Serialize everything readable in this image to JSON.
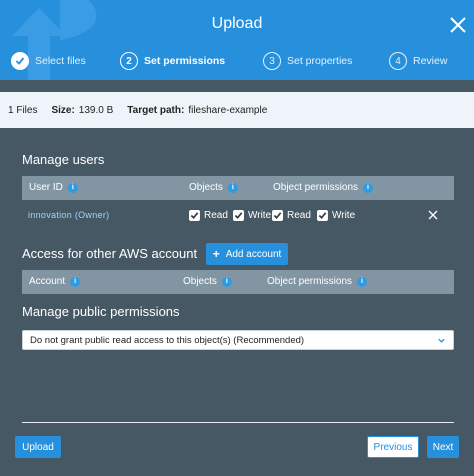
{
  "header": {
    "title": "Upload",
    "steps": [
      {
        "num": "1",
        "label": "Select files",
        "state": "done"
      },
      {
        "num": "2",
        "label": "Set permissions",
        "state": "active"
      },
      {
        "num": "3",
        "label": "Set properties",
        "state": "pending"
      },
      {
        "num": "4",
        "label": "Review",
        "state": "pending"
      }
    ]
  },
  "summary": {
    "files": "1 Files",
    "size_label": "Size:",
    "size_value": "139.0 B",
    "target_label": "Target path:",
    "target_value": "fileshare-example"
  },
  "manage_users": {
    "title": "Manage users",
    "columns": {
      "user_id": "User ID",
      "objects": "Objects",
      "object_permissions": "Object permissions"
    },
    "rows": [
      {
        "user_id": "innovation (Owner)",
        "objects_read": "Read",
        "objects_write": "Write",
        "perm_read": "Read",
        "perm_write": "Write"
      }
    ]
  },
  "other_accounts": {
    "title": "Access for other AWS account",
    "add_button": "Add account",
    "columns": {
      "account": "Account",
      "objects": "Objects",
      "object_permissions": "Object permissions"
    }
  },
  "public_permissions": {
    "title": "Manage public permissions",
    "selected": "Do not grant public read access to this object(s) (Recommended)"
  },
  "footer": {
    "upload": "Upload",
    "previous": "Previous",
    "next": "Next"
  },
  "colors": {
    "header_blue": "#2790dd",
    "panel_bg": "#475865",
    "table_header": "#8295a3",
    "summary_bg": "#eef4f9"
  },
  "icons": {
    "close": "close-icon",
    "info": "info-icon",
    "check": "check-icon",
    "remove": "remove-icon",
    "chevron": "chevron-down-icon",
    "plus": "plus-icon"
  }
}
